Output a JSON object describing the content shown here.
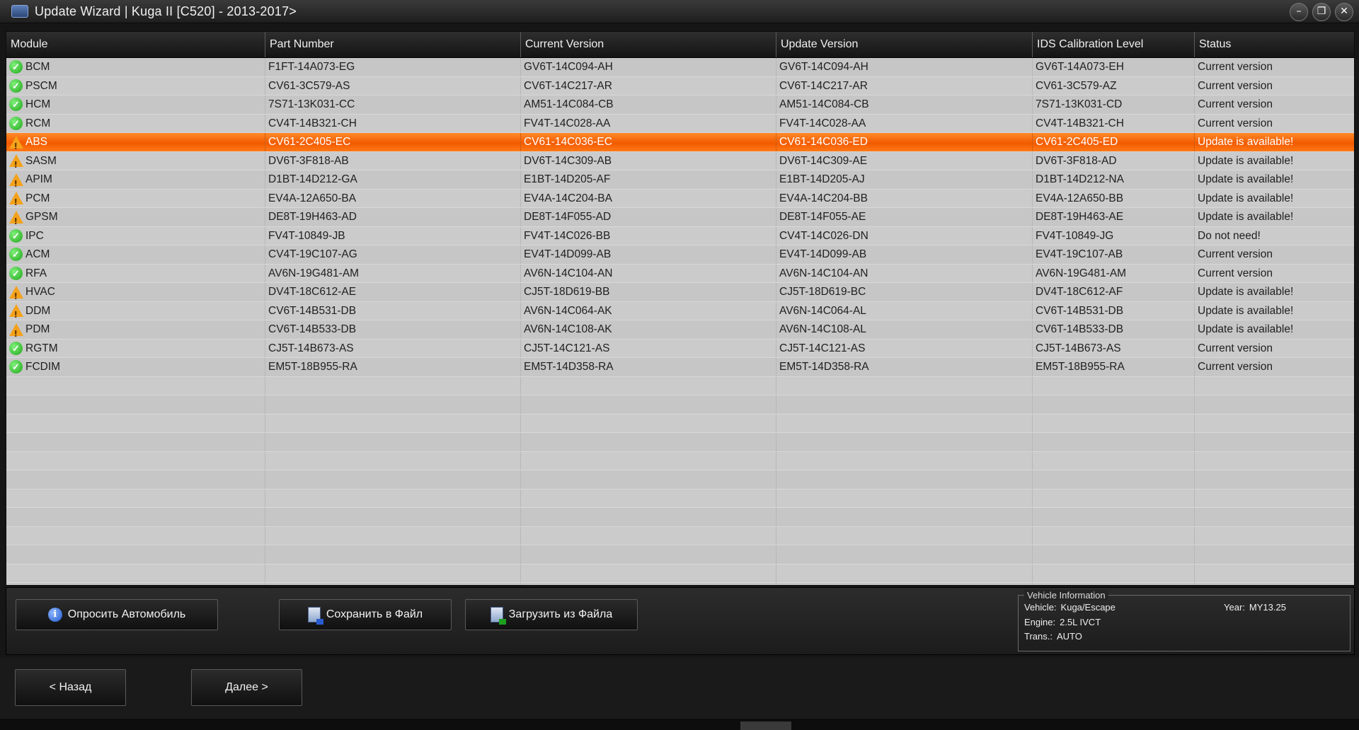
{
  "window": {
    "title": "Update Wizard | Kuga II [C520] - 2013-2017>",
    "controls": [
      "–",
      "❐",
      "✕"
    ]
  },
  "table": {
    "columns": [
      "Module",
      "Part Number",
      "Current Version",
      "Update Version",
      "IDS Calibration Level",
      "Status"
    ],
    "rows": [
      {
        "status_type": "ok",
        "module": "BCM",
        "part": "F1FT-14A073-EG",
        "current": "GV6T-14C094-AH",
        "update": "GV6T-14C094-AH",
        "ids": "GV6T-14A073-EH",
        "status": "Current version"
      },
      {
        "status_type": "ok",
        "module": "PSCM",
        "part": "CV61-3C579-AS",
        "current": "CV6T-14C217-AR",
        "update": "CV6T-14C217-AR",
        "ids": "CV61-3C579-AZ",
        "status": "Current version"
      },
      {
        "status_type": "ok",
        "module": "HCM",
        "part": "7S71-13K031-CC",
        "current": "AM51-14C084-CB",
        "update": "AM51-14C084-CB",
        "ids": "7S71-13K031-CD",
        "status": "Current version"
      },
      {
        "status_type": "ok",
        "module": "RCM",
        "part": "CV4T-14B321-CH",
        "current": "FV4T-14C028-AA",
        "update": "FV4T-14C028-AA",
        "ids": "CV4T-14B321-CH",
        "status": "Current version"
      },
      {
        "status_type": "warn",
        "module": "ABS",
        "part": "CV61-2C405-EC",
        "current": "CV61-14C036-EC",
        "update": "CV61-14C036-ED",
        "ids": "CV61-2C405-ED",
        "status": "Update is available!",
        "selected": true
      },
      {
        "status_type": "warn",
        "module": "SASM",
        "part": "DV6T-3F818-AB",
        "current": "DV6T-14C309-AB",
        "update": "DV6T-14C309-AE",
        "ids": "DV6T-3F818-AD",
        "status": "Update is available!"
      },
      {
        "status_type": "warn",
        "module": "APIM",
        "part": "D1BT-14D212-GA",
        "current": "E1BT-14D205-AF",
        "update": "E1BT-14D205-AJ",
        "ids": "D1BT-14D212-NA",
        "status": "Update is available!"
      },
      {
        "status_type": "warn",
        "module": "PCM",
        "part": "EV4A-12A650-BA",
        "current": "EV4A-14C204-BA",
        "update": "EV4A-14C204-BB",
        "ids": "EV4A-12A650-BB",
        "status": "Update is available!"
      },
      {
        "status_type": "warn",
        "module": "GPSM",
        "part": "DE8T-19H463-AD",
        "current": "DE8T-14F055-AD",
        "update": "DE8T-14F055-AE",
        "ids": "DE8T-19H463-AE",
        "status": "Update is available!"
      },
      {
        "status_type": "ok",
        "module": "IPC",
        "part": "FV4T-10849-JB",
        "current": "FV4T-14C026-BB",
        "update": "CV4T-14C026-DN",
        "ids": "FV4T-10849-JG",
        "status": "Do not need!"
      },
      {
        "status_type": "ok",
        "module": "ACM",
        "part": "CV4T-19C107-AG",
        "current": "EV4T-14D099-AB",
        "update": "EV4T-14D099-AB",
        "ids": "EV4T-19C107-AB",
        "status": "Current version"
      },
      {
        "status_type": "ok",
        "module": "RFA",
        "part": "AV6N-19G481-AM",
        "current": "AV6N-14C104-AN",
        "update": "AV6N-14C104-AN",
        "ids": "AV6N-19G481-AM",
        "status": "Current version"
      },
      {
        "status_type": "warn",
        "module": "HVAC",
        "part": "DV4T-18C612-AE",
        "current": "CJ5T-18D619-BB",
        "update": "CJ5T-18D619-BC",
        "ids": "DV4T-18C612-AF",
        "status": "Update is available!"
      },
      {
        "status_type": "warn",
        "module": "DDM",
        "part": "CV6T-14B531-DB",
        "current": "AV6N-14C064-AK",
        "update": "AV6N-14C064-AL",
        "ids": "CV6T-14B531-DB",
        "status": "Update is available!"
      },
      {
        "status_type": "warn",
        "module": "PDM",
        "part": "CV6T-14B533-DB",
        "current": "AV6N-14C108-AK",
        "update": "AV6N-14C108-AL",
        "ids": "CV6T-14B533-DB",
        "status": "Update is available!"
      },
      {
        "status_type": "ok",
        "module": "RGTM",
        "part": "CJ5T-14B673-AS",
        "current": "CJ5T-14C121-AS",
        "update": "CJ5T-14C121-AS",
        "ids": "CJ5T-14B673-AS",
        "status": "Current version"
      },
      {
        "status_type": "ok",
        "module": "FCDIM",
        "part": "EM5T-18B955-RA",
        "current": "EM5T-14D358-RA",
        "update": "EM5T-14D358-RA",
        "ids": "EM5T-18B955-RA",
        "status": "Current version"
      }
    ],
    "colors": {
      "selected": "#f25a00",
      "ok": "#1fa51a",
      "warn": "#f4a21b"
    }
  },
  "actions": {
    "poll_label": "Опросить Автомобиль",
    "save_label": "Сохранить в Файл",
    "load_label": "Загрузить из Файла"
  },
  "vehicle_info": {
    "legend": "Vehicle Information",
    "vehicle_key": "Vehicle:",
    "vehicle_val": "Kuga/Escape",
    "engine_key": "Engine:",
    "engine_val": "2.5L IVCT",
    "trans_key": "Trans.:",
    "trans_val": "AUTO",
    "year_key": "Year:",
    "year_val": "MY13.25"
  },
  "nav": {
    "back_label": "< Назад",
    "next_label": "Далее >"
  }
}
